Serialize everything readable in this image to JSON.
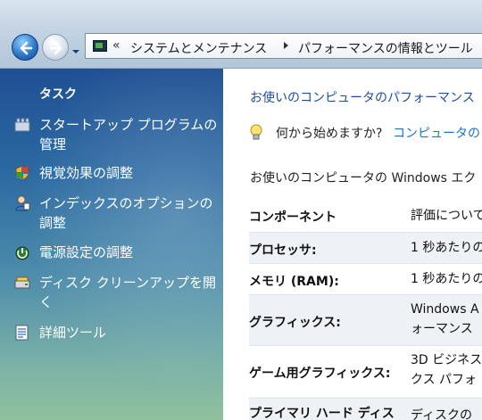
{
  "address_bar": {
    "chevron": "«",
    "segment1": "システムとメンテナンス",
    "segment2": "パフォーマンスの情報とツール"
  },
  "task_pane": {
    "title": "タスク",
    "items": [
      {
        "label": "スタートアップ プログラムの管理",
        "icon": "startup-programs-icon"
      },
      {
        "label": "視覚効果の調整",
        "icon": "shield-icon"
      },
      {
        "label": "インデックスのオプションの調整",
        "icon": "indexing-icon"
      },
      {
        "label": "電源設定の調整",
        "icon": "power-icon"
      },
      {
        "label": "ディスク クリーンアップを開く",
        "icon": "disk-cleanup-icon"
      },
      {
        "label": "詳細ツール",
        "icon": "advanced-tools-icon"
      }
    ]
  },
  "main": {
    "heading": "お使いのコンピュータのパフォーマンス",
    "tip_text": "何から始めますか?",
    "tip_link": "コンピュータの",
    "intro": "お使いのコンピュータの Windows エク",
    "table": {
      "header": {
        "name": "コンポーネント",
        "desc": "評価について"
      },
      "rows": [
        {
          "name": "プロセッサ:",
          "desc": [
            "1 秒あたりの"
          ]
        },
        {
          "name": "メモリ (RAM):",
          "desc": [
            "1 秒あたりの"
          ]
        },
        {
          "name": "グラフィックス:",
          "desc": [
            "Windows A",
            "ォーマンス"
          ]
        },
        {
          "name": "ゲーム用グラフィックス:",
          "desc": [
            "3D ビジネス",
            "クス パフォ"
          ]
        },
        {
          "name": "プライマリ ハード ディス",
          "desc": [
            "ディスクの"
          ]
        }
      ]
    }
  },
  "colors": {
    "task_pane_top": "#1f4f93",
    "task_pane_bottom": "#90c19d",
    "link_blue": "#1f4e9c",
    "tip_link_blue": "#1f72c8"
  }
}
